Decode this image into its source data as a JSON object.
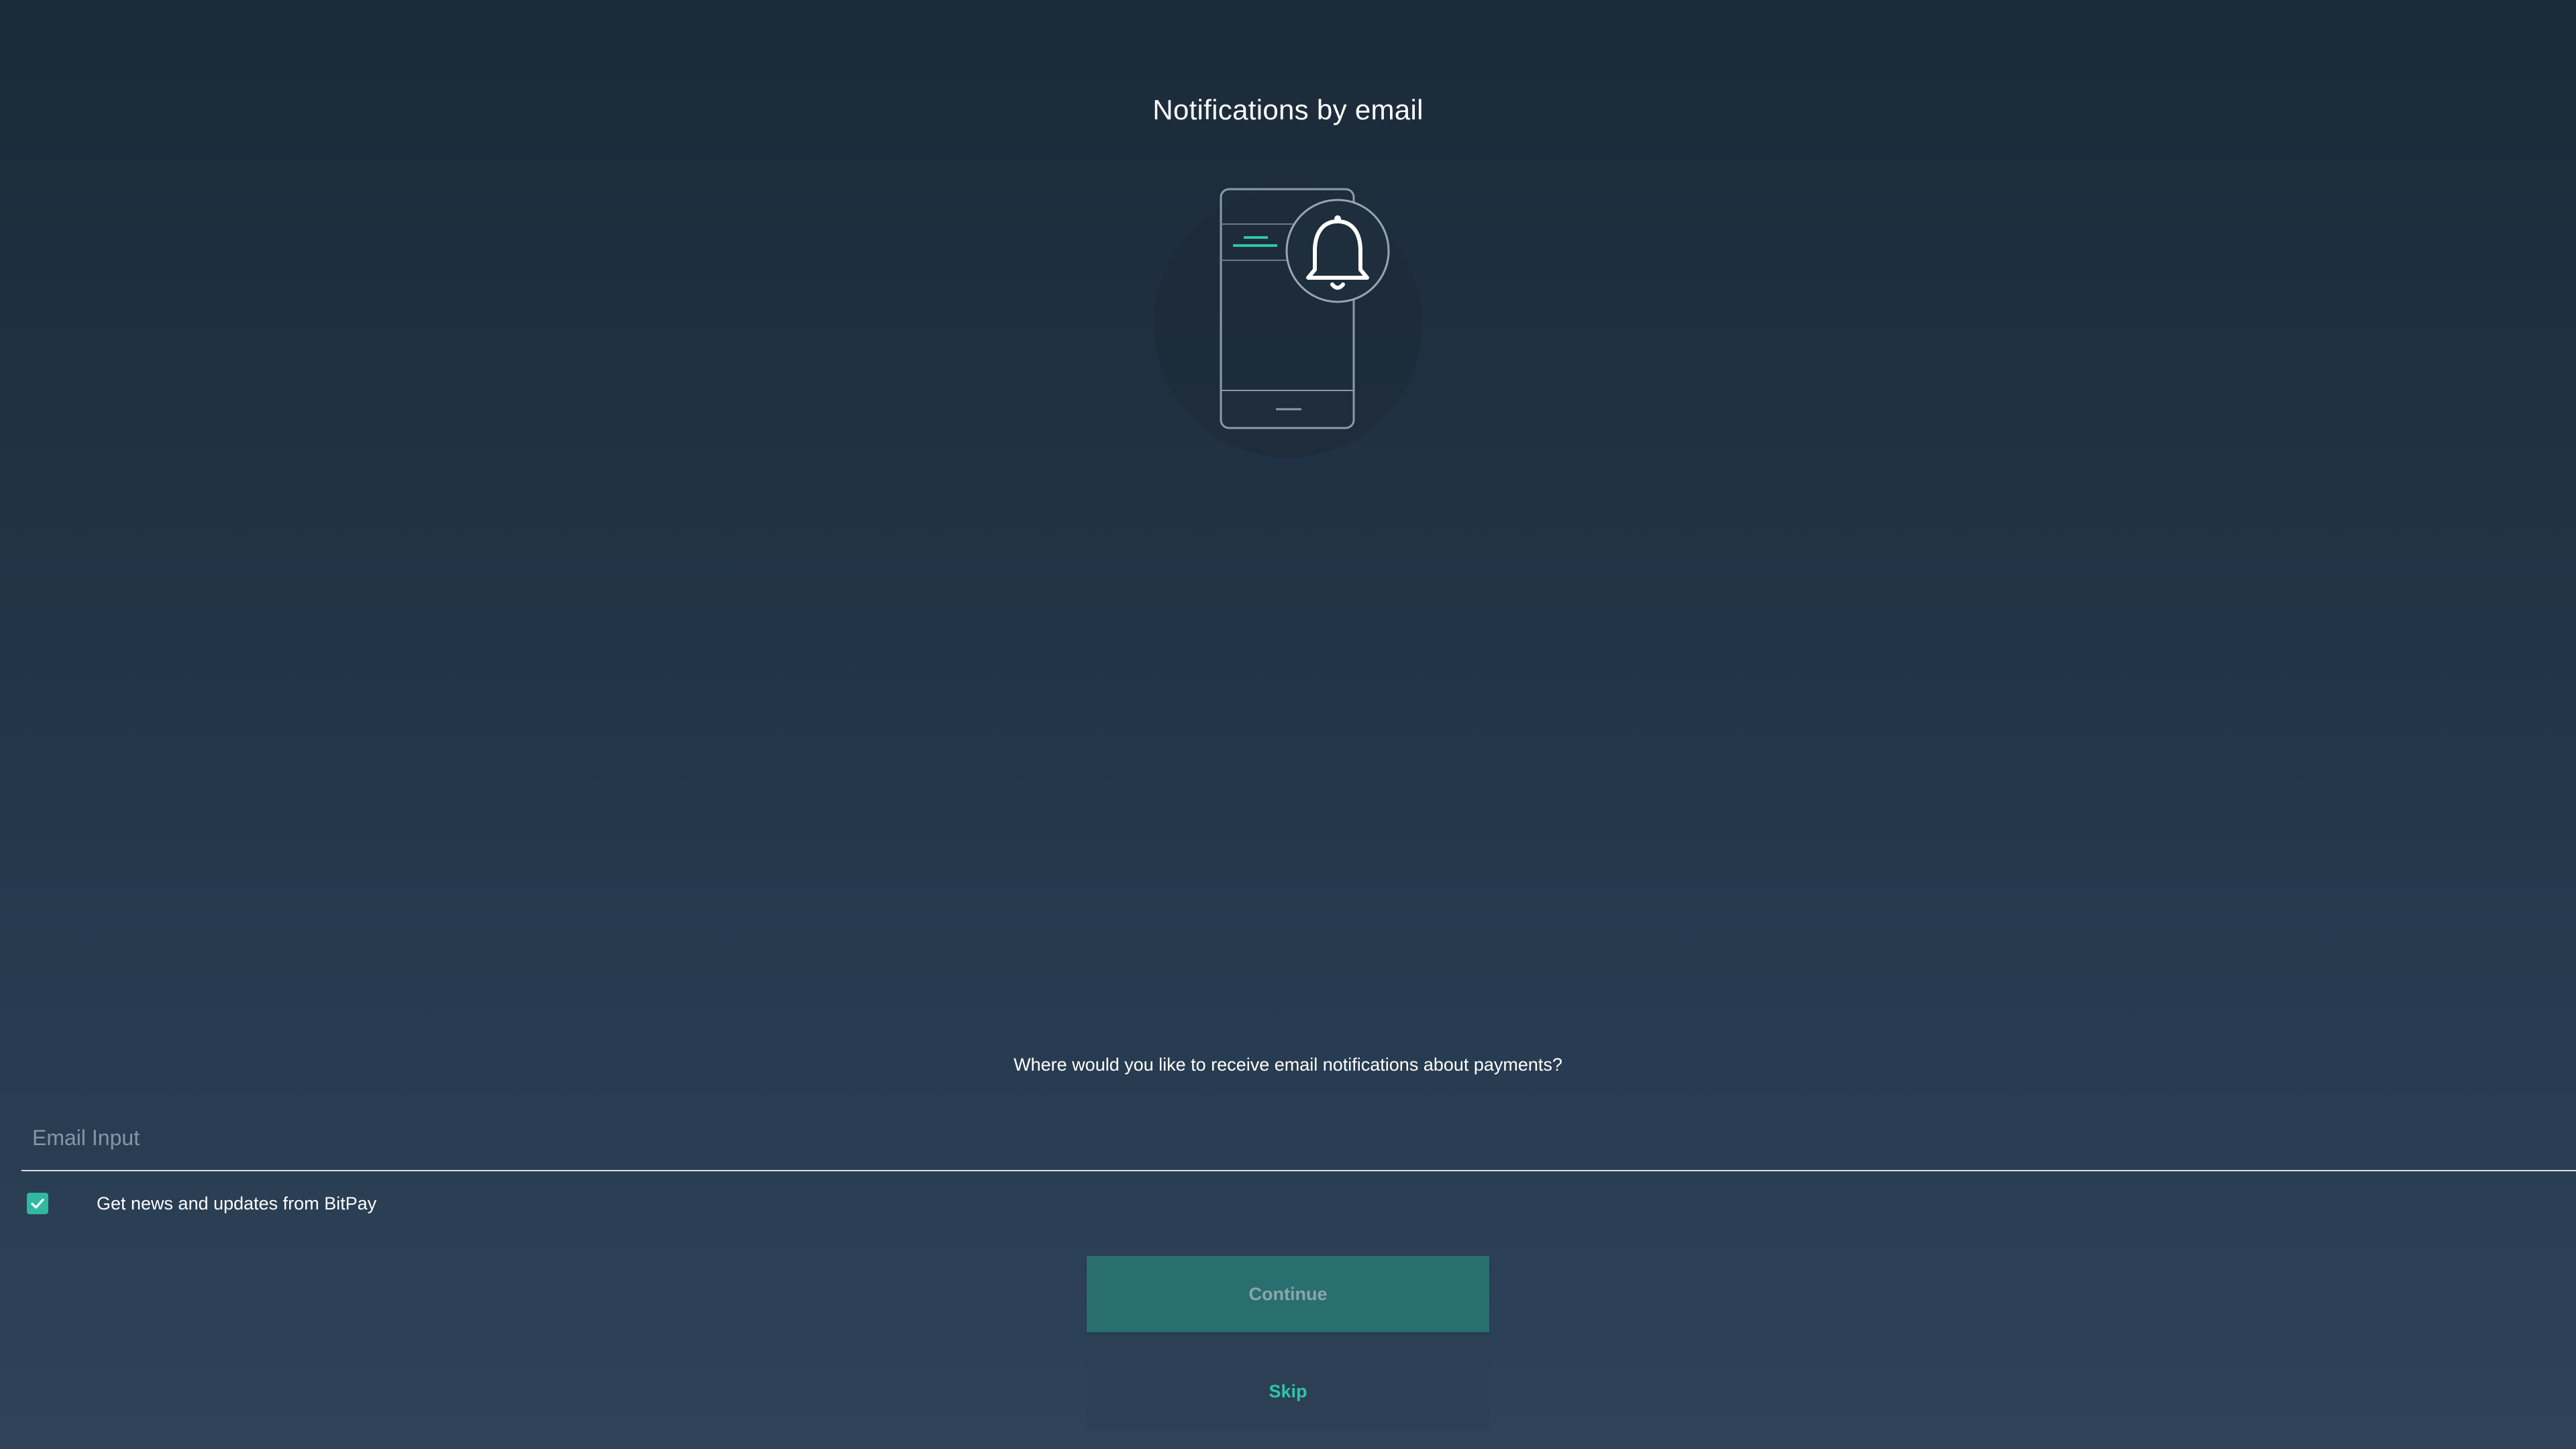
{
  "header": {
    "title": "Notifications by email"
  },
  "illustration": {
    "icon": "phone-bell-icon",
    "accent_color": "#2fc4a7"
  },
  "form": {
    "question": "Where would you like to receive email notifications about payments?",
    "email": {
      "value": "",
      "placeholder": "Email Input"
    },
    "news_checkbox": {
      "label": "Get news and updates from BitPay",
      "checked": true
    }
  },
  "actions": {
    "continue_label": "Continue",
    "skip_label": "Skip"
  },
  "colors": {
    "accent": "#2fc4a7",
    "continue_bg": "#2a6f70",
    "skip_bg": "#2c3f55"
  }
}
